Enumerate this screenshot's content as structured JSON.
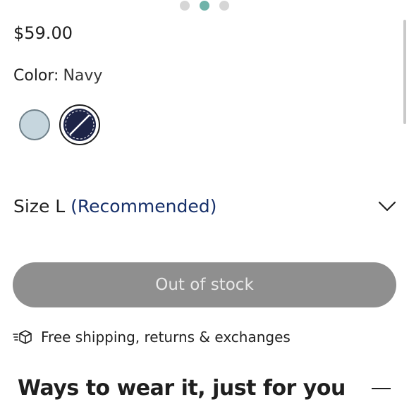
{
  "carousel": {
    "active_index": 1,
    "count": 3
  },
  "product": {
    "price": "$59.00",
    "color_label": "Color:",
    "color_value": "Navy",
    "swatches": [
      {
        "name": "light-blue",
        "color": "#c6d6de",
        "available": true
      },
      {
        "name": "navy",
        "color": "#1d2447",
        "available": false,
        "selected": true
      }
    ],
    "size_prefix": "Size L",
    "size_recommendation": "(Recommended)",
    "button_label": "Out of stock",
    "shipping_text": "Free shipping, returns & exchanges"
  },
  "section": {
    "title": "Ways to wear it, just for you"
  },
  "colors": {
    "accent_dot": "#6fb3a9",
    "recommended_text": "#17306a",
    "disabled_button": "#8f8f8f"
  }
}
